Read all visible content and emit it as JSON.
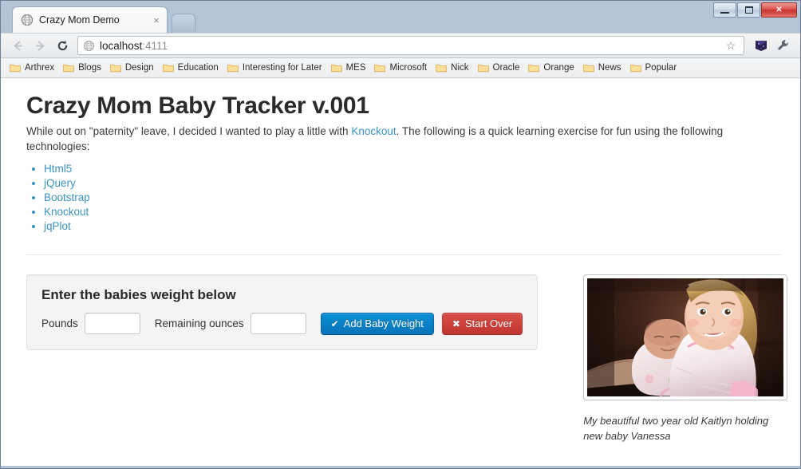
{
  "browser": {
    "window_controls": {
      "minimize_label": "Minimize",
      "maximize_label": "Maximize",
      "close_label": "✕"
    },
    "tab": {
      "title": "Crazy Mom Demo",
      "close_label": "×",
      "favicon": "globe-icon"
    },
    "new_tab_label": "New Tab",
    "nav": {
      "back_label": "←",
      "forward_label": "→",
      "reload_label": "⟳"
    },
    "omnibox": {
      "host": "localhost",
      "port": ":4111",
      "full_url": "localhost:4111",
      "page_icon": "globe-icon",
      "star_label": "☆"
    },
    "toolbar_icons": [
      "extension-icon",
      "wrench-menu-icon"
    ],
    "bookmarks": [
      {
        "label": "Arthrex"
      },
      {
        "label": "Blogs"
      },
      {
        "label": "Design"
      },
      {
        "label": "Education"
      },
      {
        "label": "Interesting for Later"
      },
      {
        "label": "MES"
      },
      {
        "label": "Microsoft"
      },
      {
        "label": "Nick"
      },
      {
        "label": "Oracle"
      },
      {
        "label": "Orange"
      },
      {
        "label": "News"
      },
      {
        "label": "Popular"
      }
    ]
  },
  "page": {
    "title": "Crazy Mom Baby Tracker v.001",
    "lead_before_link": "While out on \"paternity\" leave, I decided I wanted to play a little with ",
    "lead_link": "Knockout",
    "lead_after_link": ". The following is a quick learning exercise for fun using the following technologies:",
    "technologies": [
      {
        "label": "Html5"
      },
      {
        "label": "jQuery"
      },
      {
        "label": "Bootstrap"
      },
      {
        "label": "Knockout"
      },
      {
        "label": "jqPlot"
      }
    ],
    "form": {
      "heading": "Enter the babies weight below",
      "pounds_label": "Pounds",
      "pounds_value": "",
      "pounds_placeholder": "",
      "ounces_label": "Remaining ounces",
      "ounces_value": "",
      "ounces_placeholder": "",
      "add_button_label": "Add Baby Weight",
      "add_button_icon": "✔",
      "reset_button_label": "Start Over",
      "reset_button_icon": "✖"
    },
    "thumbnail": {
      "alt": "Two year old girl holding a newborn baby",
      "caption": "My beautiful two year old Kaitlyn holding new baby Vanessa"
    }
  },
  "colors": {
    "link": "#3a92bf",
    "primary_button": "#0a73b8",
    "danger_button": "#bd362f",
    "well_background": "#f4f4f4",
    "heading": "#2b2b2b"
  }
}
